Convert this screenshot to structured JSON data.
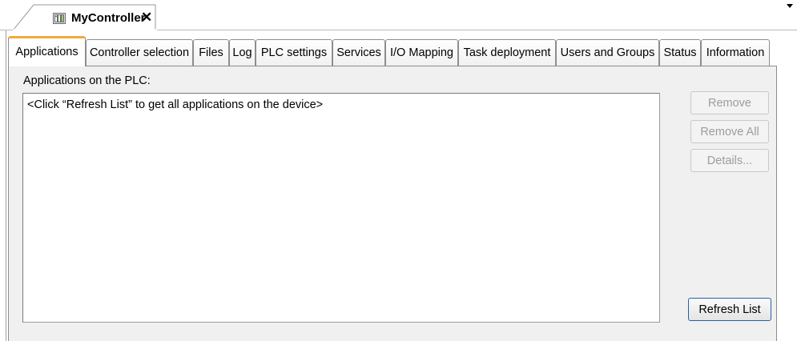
{
  "document_tab": {
    "title": "MyController",
    "icon": "controller-device-icon",
    "close_icon": "close-icon"
  },
  "subtabs": [
    {
      "label": "Applications",
      "active": true
    },
    {
      "label": "Controller selection",
      "active": false
    },
    {
      "label": "Files",
      "active": false
    },
    {
      "label": "Log",
      "active": false
    },
    {
      "label": "PLC settings",
      "active": false
    },
    {
      "label": "Services",
      "active": false
    },
    {
      "label": "I/O Mapping",
      "active": false
    },
    {
      "label": "Task deployment",
      "active": false
    },
    {
      "label": "Users and Groups",
      "active": false
    },
    {
      "label": "Status",
      "active": false
    },
    {
      "label": "Information",
      "active": false
    }
  ],
  "panel": {
    "label": "Applications on the PLC:",
    "list_items": [
      "<Click “Refresh List” to get all applications on the device>"
    ]
  },
  "buttons": {
    "remove": {
      "label": "Remove",
      "enabled": false
    },
    "remove_all": {
      "label": "Remove All",
      "enabled": false
    },
    "details": {
      "label": "Details...",
      "enabled": false
    },
    "refresh": {
      "label": "Refresh List",
      "enabled": true
    }
  },
  "colors": {
    "active_tab_accent": "#f2a93b",
    "panel_bg": "#f0f0f0",
    "focus_border": "#2b5fa8"
  }
}
